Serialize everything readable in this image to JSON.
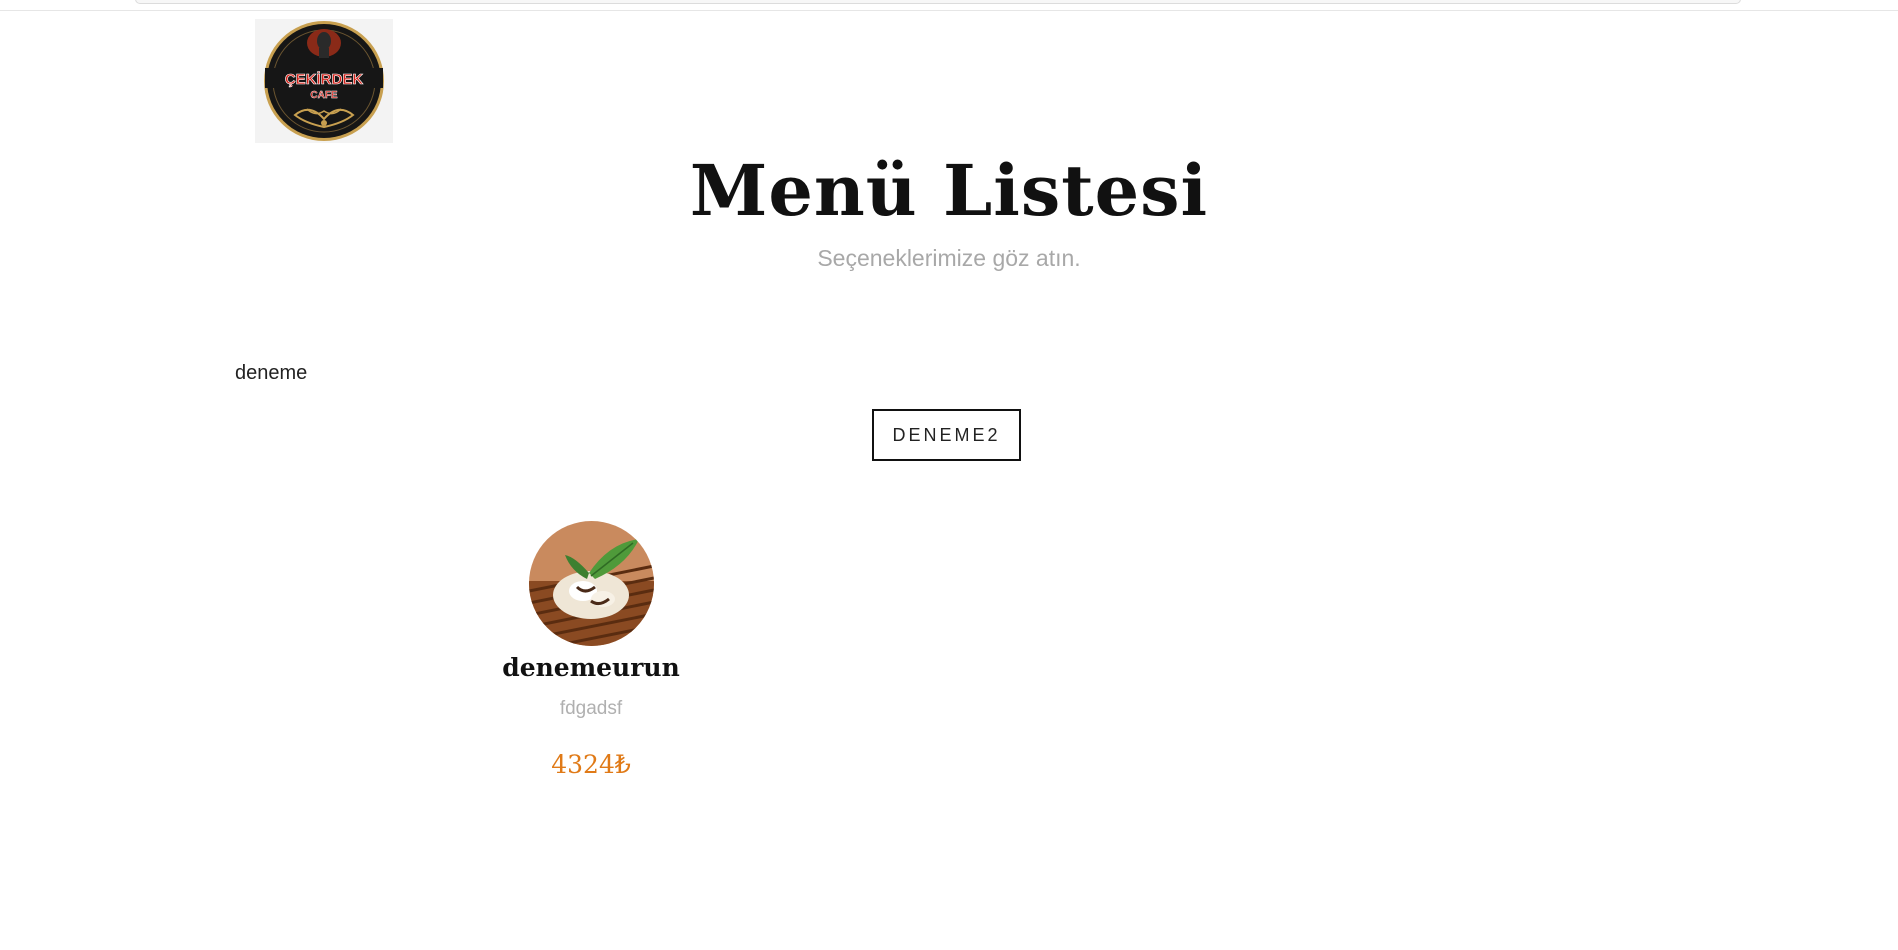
{
  "header": {
    "logo": {
      "line1": "ÇEKİRDEK",
      "line2": "CAFE"
    }
  },
  "hero": {
    "title": "Menü Listesi",
    "subtitle": "Seçeneklerimize göz atın."
  },
  "category": {
    "label": "deneme"
  },
  "filters": {
    "button_label": "DENEME2"
  },
  "items": [
    {
      "name": "denemeurun",
      "description": "fdgadsf",
      "price": "4324₺"
    }
  ],
  "colors": {
    "price_accent": "#e07a17",
    "subtitle_gray": "#a8a8a8",
    "logo_red": "#d4221a",
    "logo_gold": "#c8a050"
  }
}
